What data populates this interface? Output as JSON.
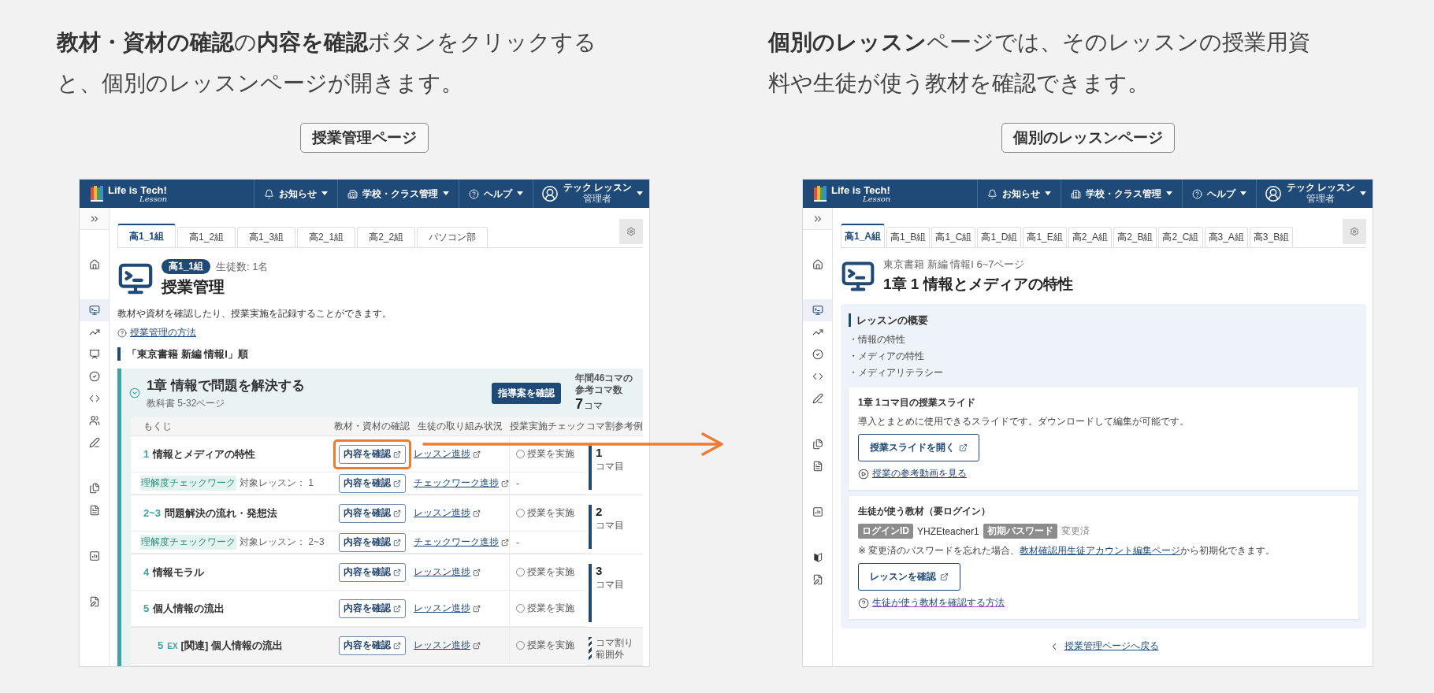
{
  "panels": [
    {
      "caption": "**教材・資材の確認**の**内容を確認**ボタンをクリックすると、個別のレッスンページが開きます。",
      "label": "授業管理ページ",
      "app": {
        "header": {
          "logo": "Life is Tech!",
          "logo_sub": "Lesson",
          "menus": [
            {
              "kind": "bell",
              "label": "お知らせ"
            },
            {
              "kind": "building",
              "label": "学校・クラス管理"
            },
            {
              "kind": "help",
              "label": "ヘルプ"
            }
          ],
          "user": {
            "name": "テック レッスン",
            "role": "管理者"
          }
        },
        "sidebar": {
          "groups": [
            [
              {
                "kind": "expand",
                "selected": false
              }
            ],
            [
              {
                "kind": "home",
                "selected": false
              }
            ],
            [
              {
                "kind": "monitor",
                "selected": true
              },
              {
                "kind": "trending",
                "selected": false
              },
              {
                "kind": "presentation",
                "selected": false
              },
              {
                "kind": "check",
                "selected": false
              },
              {
                "kind": "code",
                "selected": false
              },
              {
                "kind": "users",
                "selected": false
              },
              {
                "kind": "pencil",
                "selected": false
              }
            ],
            [
              {
                "kind": "files",
                "selected": false
              },
              {
                "kind": "file_edit",
                "selected": false
              }
            ],
            [
              {
                "kind": "chart",
                "selected": false
              }
            ],
            [
              {
                "kind": "file_pen",
                "selected": false
              }
            ]
          ]
        },
        "tabs": [
          {
            "label": "高1_1組",
            "selected": true
          },
          {
            "label": "高1_2組",
            "selected": false
          },
          {
            "label": "高1_3組",
            "selected": false
          },
          {
            "label": "高2_1組",
            "selected": false
          },
          {
            "label": "高2_2組",
            "selected": false
          },
          {
            "label": "パソコン部",
            "selected": false
          }
        ],
        "page": {
          "kind": "class_management",
          "badge": "高1_1組",
          "student_count": "生徒数: 1名",
          "title": "授業管理",
          "description": "教材や資材を確認したり、授業実施を記録することができます。",
          "help_link": "授業管理の方法",
          "section": "「東京書籍 新編 情報I」順",
          "chapter": {
            "expanded": true,
            "title": "1章 情報で問題を解決する",
            "pages": "教科書 5-32ページ",
            "plan_button": "指導案を確認",
            "annual_note": [
              "年間46コマの",
              "参考コマ数"
            ],
            "count": "7",
            "count_unit": "コマ",
            "columns": [
              "もくじ",
              "教材・資材の確認",
              "生徒の取り組み状況",
              "授業実施チェック",
              "コマ割参考例"
            ],
            "groups": [
              {
                "kind": "koma",
                "number": "1",
                "unit": "コマ目",
                "rows": [
                  {
                    "kind": "lesson",
                    "number": "1",
                    "title": "情報とメディアの特性",
                    "button": "内容を確認",
                    "highlighted": true,
                    "progress": "レッスン進捗",
                    "check": "授業を実施",
                    "done": false
                  },
                  {
                    "kind": "checkwork",
                    "tag": "理解度チェックワーク",
                    "target": "対象レッスン： 1",
                    "button": "内容を確認",
                    "highlighted": false,
                    "progress": "チェックワーク進捗",
                    "check": "-"
                  }
                ]
              },
              {
                "kind": "koma",
                "number": "2",
                "unit": "コマ目",
                "rows": [
                  {
                    "kind": "lesson",
                    "number": "2~3",
                    "title": "問題解決の流れ・発想法",
                    "button": "内容を確認",
                    "highlighted": false,
                    "progress": "レッスン進捗",
                    "check": "授業を実施",
                    "done": false
                  },
                  {
                    "kind": "checkwork",
                    "tag": "理解度チェックワーク",
                    "target": "対象レッスン： 2~3",
                    "button": "内容を確認",
                    "highlighted": false,
                    "progress": "チェックワーク進捗",
                    "check": "-"
                  }
                ]
              },
              {
                "kind": "koma",
                "number": "3",
                "unit": "コマ目",
                "rows": [
                  {
                    "kind": "lesson",
                    "number": "4",
                    "title": "情報モラル",
                    "button": "内容を確認",
                    "highlighted": false,
                    "progress": "レッスン進捗",
                    "check": "授業を実施",
                    "done": false
                  },
                  {
                    "kind": "lesson",
                    "number": "5",
                    "title": "個人情報の流出",
                    "button": "内容を確認",
                    "highlighted": false,
                    "progress": "レッスン進捗",
                    "check": "授業を実施",
                    "done": false
                  }
                ]
              },
              {
                "kind": "out_of_range",
                "lines": [
                  "コマ割り",
                  "範囲外"
                ],
                "rows": [
                  {
                    "kind": "related",
                    "number": "5",
                    "suffix": "EX",
                    "title": "[関連] 個人情報の流出",
                    "button": "内容を確認",
                    "highlighted": false,
                    "progress": "レッスン進捗",
                    "check": "授業を実施",
                    "done": false
                  }
                ]
              }
            ]
          }
        }
      }
    },
    {
      "caption": "**個別のレッスン**ページでは、そのレッスンの授業用資料や生徒が使う教材を確認できます。",
      "label": "個別のレッスンページ",
      "app": {
        "header": {
          "logo": "Life is Tech!",
          "logo_sub": "Lesson",
          "menus": [
            {
              "kind": "bell",
              "label": "お知らせ"
            },
            {
              "kind": "building",
              "label": "学校・クラス管理"
            },
            {
              "kind": "help",
              "label": "ヘルプ"
            }
          ],
          "user": {
            "name": "テック レッスン",
            "role": "管理者"
          }
        },
        "sidebar": {
          "groups": [
            [
              {
                "kind": "expand",
                "selected": false
              }
            ],
            [
              {
                "kind": "home",
                "selected": false
              }
            ],
            [
              {
                "kind": "monitor",
                "selected": true
              },
              {
                "kind": "trending",
                "selected": false
              },
              {
                "kind": "check",
                "selected": false
              },
              {
                "kind": "code",
                "selected": false
              },
              {
                "kind": "pencil",
                "selected": false
              }
            ],
            [
              {
                "kind": "files",
                "selected": false
              },
              {
                "kind": "file_edit",
                "selected": false
              }
            ],
            [
              {
                "kind": "chart",
                "selected": false
              }
            ],
            [
              {
                "kind": "beginner",
                "selected": false
              },
              {
                "kind": "file_pen",
                "selected": false
              }
            ]
          ]
        },
        "tabs": [
          {
            "label": "高1_A組",
            "selected": true
          },
          {
            "label": "高1_B組",
            "selected": false
          },
          {
            "label": "高1_C組",
            "selected": false
          },
          {
            "label": "高1_D組",
            "selected": false
          },
          {
            "label": "高1_E組",
            "selected": false
          },
          {
            "label": "高2_A組",
            "selected": false
          },
          {
            "label": "高2_B組",
            "selected": false
          },
          {
            "label": "高2_C組",
            "selected": false
          },
          {
            "label": "高3_A組",
            "selected": false
          },
          {
            "label": "高3_B組",
            "selected": false
          }
        ],
        "page": {
          "kind": "lesson",
          "subtitle": "東京書籍 新編 情報I 6~7ページ",
          "title": "1章 1 情報とメディアの特性",
          "overview": {
            "heading": "レッスンの概要",
            "items": [
              "・情報の特性",
              "・メディアの特性",
              "・メディアリテラシー"
            ]
          },
          "cards": [
            {
              "kind": "slides",
              "title": "1章 1コマ目の授業スライド",
              "description": "導入とまとめに使用できるスライドです。ダウンロードして編集が可能です。",
              "button": "授業スライドを開く",
              "link": "授業の参考動画を見る"
            },
            {
              "kind": "materials",
              "title": "生徒が使う教材（要ログイン）",
              "login_id_label": "ログインID",
              "login_id": "YHZEteacher1",
              "password_label": "初期パスワード",
              "password_status": "変更済",
              "note": "※ 変更済のパスワードを忘れた場合、",
              "note_link": "教材確認用生徒アカウント編集ページ",
              "note_end": "から初期化できます。",
              "button": "レッスンを確認",
              "link": "生徒が使う教材を確認する方法",
              "link_visited": true
            }
          ],
          "back_link": "授業管理ページへ戻る"
        }
      }
    }
  ]
}
